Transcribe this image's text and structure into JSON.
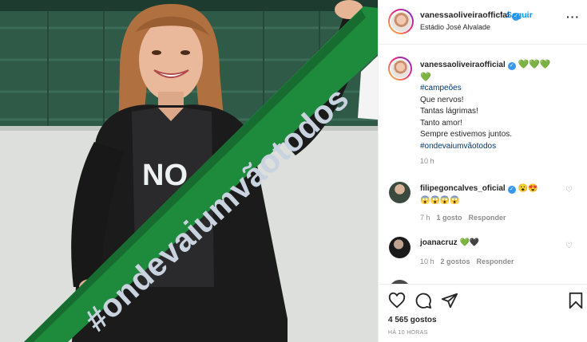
{
  "post": {
    "scarf_text": "#ondevaiumvãotodos",
    "shirt_text": "NO"
  },
  "header": {
    "username": "vanessaoliveiraofficial",
    "verified_mark": "✓",
    "separator": "•",
    "follow_label": "Seguir",
    "location": "Estádio José Alvalade",
    "more_label": "···"
  },
  "caption": {
    "username": "vanessaoliveiraofficial",
    "hearts_inline": "💚💚💚",
    "heart_line": "💚",
    "lines": [
      "#campeões",
      "Que nervos!",
      "Tantas lágrimas!",
      "Tanto amor!",
      "Sempre estivemos juntos.",
      "#ondevaiumvãotodos"
    ],
    "time": "10 h"
  },
  "comments": [
    {
      "username": "filipegoncalves_oficial",
      "text": "😮😍",
      "text2": "😱😱😱😱",
      "time": "7 h",
      "likes": "1 gosto",
      "reply": "Responder"
    },
    {
      "username": "joanacruz",
      "text": "💚🖤",
      "time": "10 h",
      "likes": "2 gostos",
      "reply": "Responder"
    }
  ],
  "icons": {
    "like": "heart-icon",
    "comment": "comment-icon",
    "share": "share-icon",
    "save": "bookmark-icon",
    "verified": "verified-badge-icon"
  },
  "footer": {
    "likes": "4 565 gostos",
    "posted_ago": "HÁ 10 HORAS"
  },
  "colors": {
    "accent_blue": "#0095f6",
    "scarf_green": "#1e8a3c",
    "scarf_text": "#c9d3df"
  }
}
